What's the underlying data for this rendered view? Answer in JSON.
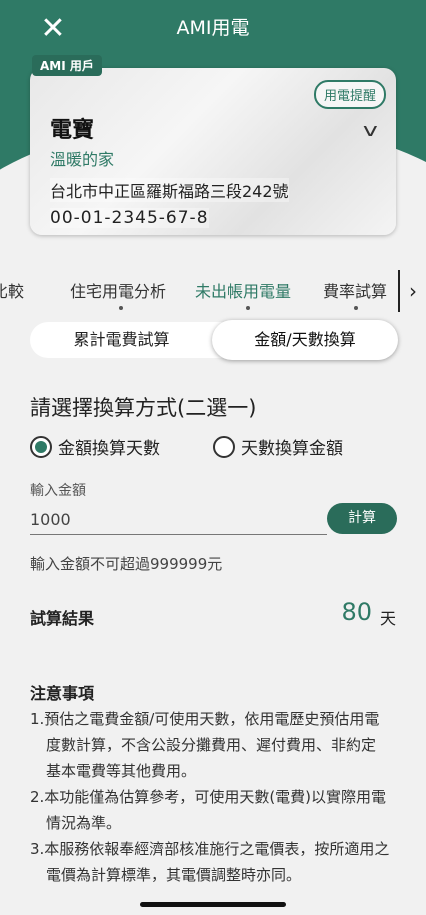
{
  "app": {
    "title": "AMI用電",
    "close_icon": "close-icon"
  },
  "account": {
    "tag": "AMI 用戶",
    "reminder_button": "用電提醒",
    "name": "電寶",
    "home_label": "溫暖的家",
    "address": "台北市中正區羅斯福路三段242號",
    "account_no": "00-01-2345-67-8",
    "expand_icon": "chevron-down-icon"
  },
  "tabs": {
    "items": [
      "比較",
      "住宅用電分析",
      "未出帳用電量",
      "費率試算"
    ],
    "active": "未出帳用電量",
    "next_icon": "chevron-right-icon"
  },
  "segment": {
    "left": "累計電費試算",
    "right": "金額/天數換算",
    "selected": "金額/天數換算"
  },
  "form": {
    "title": "請選擇換算方式(二選一)",
    "option_amount_to_days": "金額換算天數",
    "option_days_to_amount": "天數換算金額",
    "selected_option": "金額換算天數",
    "input_label": "輸入金額",
    "amount_value": "1000",
    "calc_button": "計算",
    "limit_note": "輸入金額不可超過999999元"
  },
  "result": {
    "label": "試算結果",
    "value": "80",
    "unit": "天"
  },
  "notes": {
    "title": "注意事項",
    "items": [
      "1.預估之電費金額/可使用天數，依用電歷史預估用電度數計算，不含公設分攤費用、遲付費用、非約定基本電費等其他費用。",
      "2.本功能僅為估算參考，可使用天數(電費)以實際用電情況為準。",
      "3.本服務依報奉經濟部核准施行之電價表，按所適用之電價為計算標準，其電價調整時亦同。"
    ]
  },
  "colors": {
    "brand": "#2f7a66",
    "button": "#2a6c5a",
    "background": "#f1f1f1"
  }
}
